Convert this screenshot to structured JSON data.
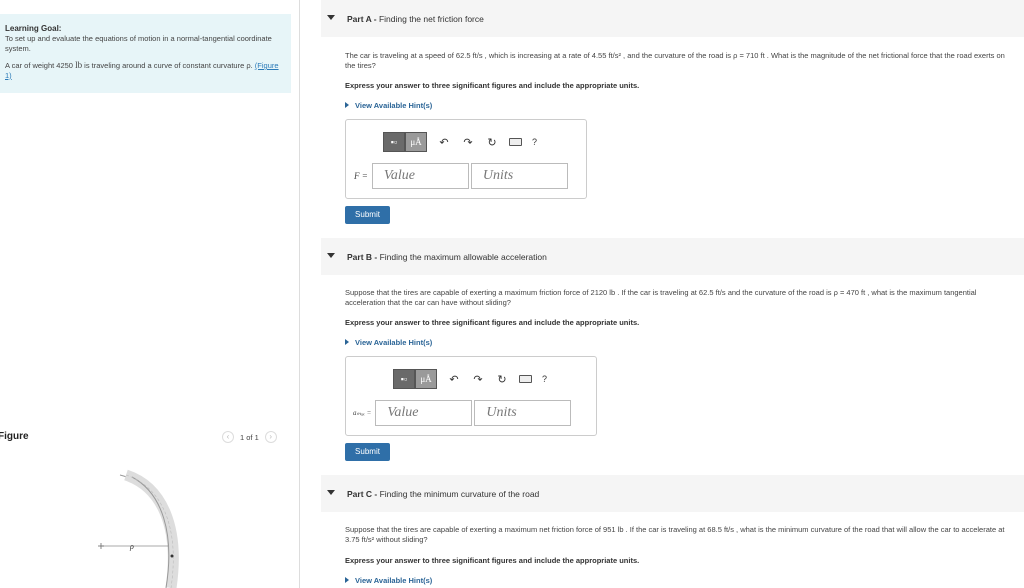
{
  "left": {
    "goal_title": "Learning Goal:",
    "goal_text": "To set up and evaluate the equations of motion in a normal-tangential coordinate system.",
    "problem_pre": "A car of weight 4250",
    "problem_unit": "lb",
    "problem_post": "is traveling around a curve of constant curvature ρ.",
    "figure_link": "(Figure 1)",
    "figure_title": "Figure",
    "figure_counter": "1 of 1",
    "figure_rho": "ρ"
  },
  "parts": [
    {
      "prefix": "Part A - ",
      "title": "Finding the net friction force",
      "question": "The car is traveling at a speed of 62.5 ft/s , which is increasing at a rate of 4.55 ft/s² , and the curvature of the road is ρ = 710 ft . What is the magnitude of the net frictional force that the road exerts on the tires?",
      "instruction": "Express your answer to three significant figures and include the appropriate units.",
      "hint": "View Available Hint(s)",
      "field_label": "F =",
      "value_placeholder": "Value",
      "units_placeholder": "Units",
      "submit": "Submit"
    },
    {
      "prefix": "Part B - ",
      "title": "Finding the maximum allowable acceleration",
      "question": "Suppose that the tires are capable of exerting a maximum friction force of 2120 lb . If the car is traveling at 62.5 ft/s and the curvature of the road is ρ = 470 ft , what is the maximum tangential acceleration that the car can have without sliding?",
      "instruction": "Express your answer to three significant figures and include the appropriate units.",
      "hint": "View Available Hint(s)",
      "field_label": "aₘₐₓ =",
      "value_placeholder": "Value",
      "units_placeholder": "Units",
      "submit": "Submit"
    },
    {
      "prefix": "Part C - ",
      "title": "Finding the minimum curvature of the road",
      "question": "Suppose that the tires are capable of exerting a maximum net friction force of 951 lb . If the car is traveling at 68.5 ft/s , what is the minimum curvature of the road that will allow the car to accelerate at 3.75 ft/s² without sliding?",
      "instruction": "Express your answer to three significant figures and include the appropriate units.",
      "hint": "View Available Hint(s)"
    }
  ],
  "toolbar": {
    "templates_icon": "templates-icon",
    "units_label": "μÅ",
    "undo_icon": "undo-icon",
    "redo_icon": "redo-icon",
    "reset_icon": "reset-icon",
    "keyboard_icon": "keyboard-icon",
    "help_label": "?"
  }
}
